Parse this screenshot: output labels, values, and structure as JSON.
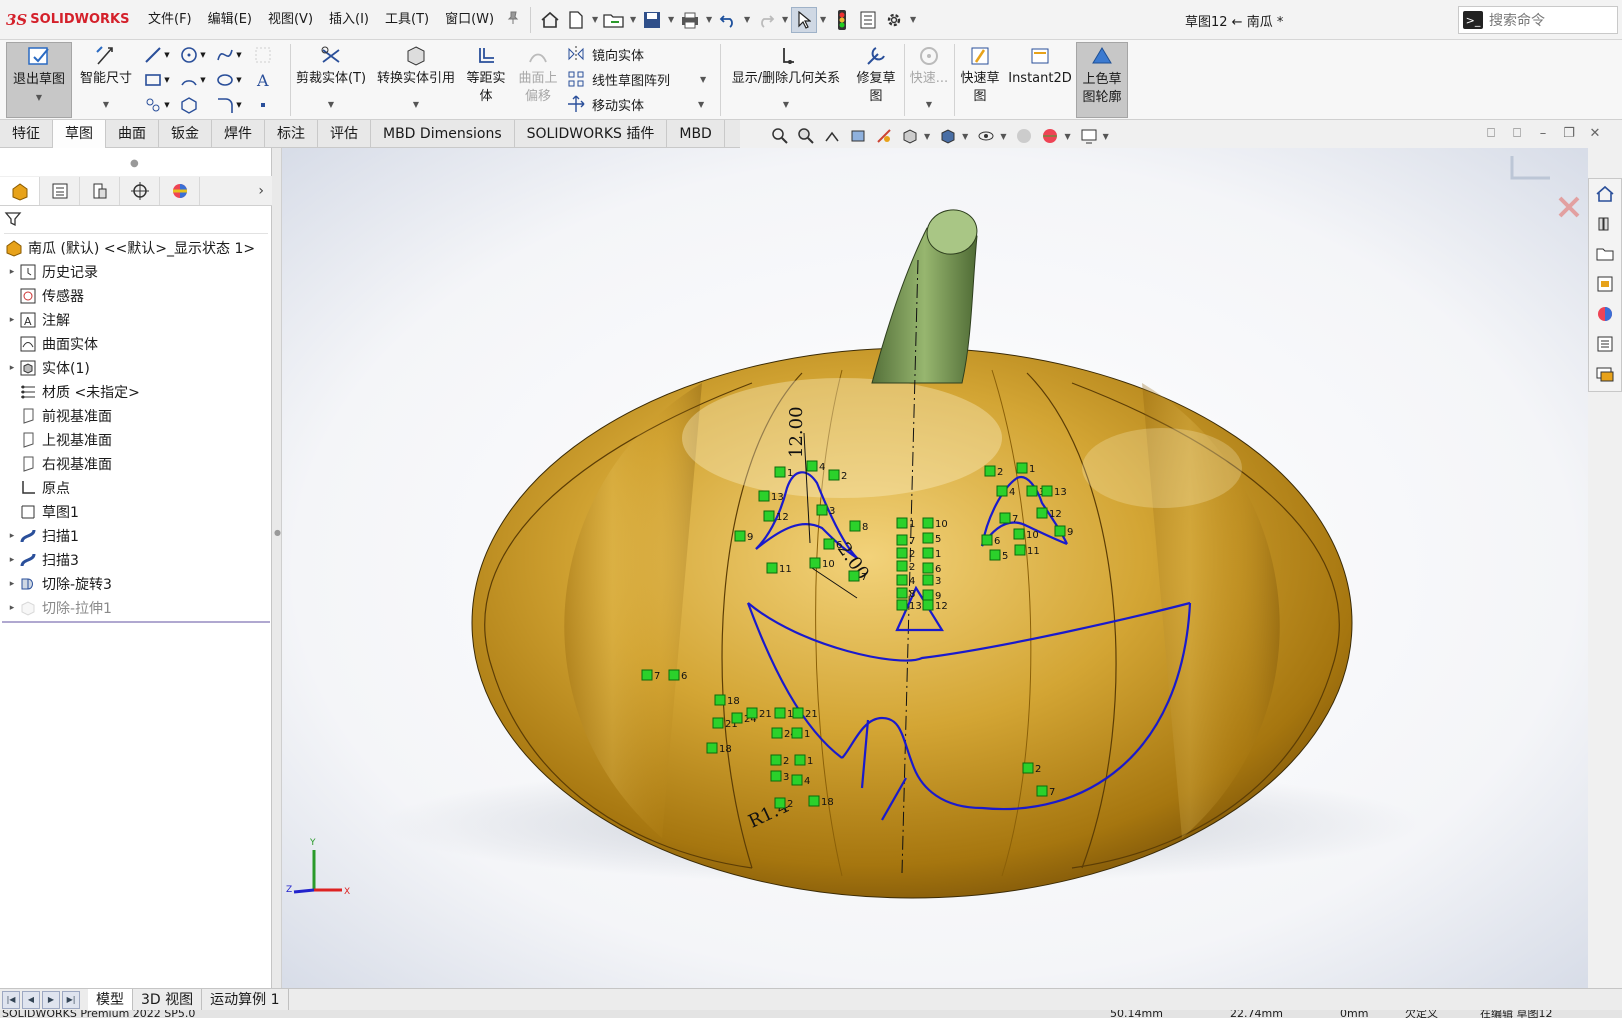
{
  "app": {
    "logo": "SOLIDWORKS",
    "logo_mark": "3S"
  },
  "menu": [
    "文件(F)",
    "编辑(E)",
    "视图(V)",
    "插入(I)",
    "工具(T)",
    "窗口(W)"
  ],
  "document_title": "草图12 ← 南瓜 *",
  "search": {
    "placeholder": "搜索命令"
  },
  "ribbon": {
    "exit_sketch": "退出草图",
    "smart_dimension": "智能尺寸",
    "trim": "剪裁实体(T)",
    "convert": "转换实体引用",
    "offset": "等距实体",
    "surface_offset": "曲面上偏移",
    "mirror": "镜向实体",
    "linear_pattern": "线性草图阵列",
    "move": "移动实体",
    "relations": "显示/删除几何关系",
    "repair": "修复草图",
    "quick_snap": "快速...",
    "rapid_sketch": "快速草图",
    "instant2d": "Instant2D",
    "shaded_contours": "上色草图轮廓"
  },
  "tabs": [
    "特征",
    "草图",
    "曲面",
    "钣金",
    "焊件",
    "标注",
    "评估",
    "MBD Dimensions",
    "SOLIDWORKS 插件",
    "MBD"
  ],
  "active_tab": "草图",
  "feature_tree": {
    "root": "南瓜 (默认) <<默认>_显示状态 1>",
    "items": [
      {
        "label": "历史记录",
        "icon": "history-icon",
        "expand": true
      },
      {
        "label": "传感器",
        "icon": "sensor-icon",
        "expand": false
      },
      {
        "label": "注解",
        "icon": "annotation-icon",
        "expand": true
      },
      {
        "label": "曲面实体",
        "icon": "surface-body-icon",
        "expand": false
      },
      {
        "label": "实体(1)",
        "icon": "solid-body-icon",
        "expand": true
      },
      {
        "label": "材质 <未指定>",
        "icon": "material-icon",
        "expand": false
      },
      {
        "label": "前视基准面",
        "icon": "plane-icon",
        "expand": false
      },
      {
        "label": "上视基准面",
        "icon": "plane-icon",
        "expand": false
      },
      {
        "label": "右视基准面",
        "icon": "plane-icon",
        "expand": false
      },
      {
        "label": "原点",
        "icon": "origin-icon",
        "expand": false
      },
      {
        "label": "草图1",
        "icon": "sketch-icon",
        "expand": false
      },
      {
        "label": "扫描1",
        "icon": "sweep-icon",
        "expand": true
      },
      {
        "label": "扫描3",
        "icon": "sweep-icon",
        "expand": true
      },
      {
        "label": "切除-旋转3",
        "icon": "revolve-cut-icon",
        "expand": true
      },
      {
        "label": "切除-拉伸1",
        "icon": "extrude-cut-icon",
        "expand": true,
        "dim": true
      }
    ]
  },
  "bottom_tabs": [
    "模型",
    "3D 视图",
    "运动算例 1"
  ],
  "active_bottom_tab": "模型",
  "status_bar": {
    "left": "SOLIDWORKS Premium 2022 SP5.0",
    "x": "50.14mm",
    "y": "22.74mm",
    "z": "0mm",
    "state": "欠定义",
    "editing": "在编辑 草图12"
  },
  "sketch_annotations": {
    "dimension_1": "12.00",
    "dimension_2": "2.00",
    "dimension_3": "R1.4",
    "relation_numbers": [
      "1",
      "2",
      "3",
      "4",
      "5",
      "6",
      "7",
      "8",
      "9",
      "10",
      "11",
      "12",
      "13",
      "18",
      "21",
      "24"
    ]
  },
  "triad": {
    "x": "X",
    "y": "Y",
    "z": "Z"
  },
  "colors": {
    "sketch_blue": "#1a1acc",
    "relation_green": "#2bd12b",
    "pumpkin": "#c9951c",
    "stem": "#7fa055"
  }
}
